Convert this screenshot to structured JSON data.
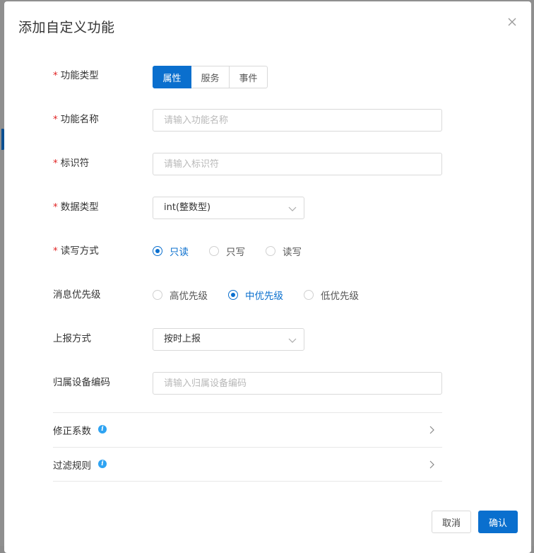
{
  "dialog": {
    "title": "添加自定义功能",
    "close_icon": "close-icon"
  },
  "form": {
    "function_type": {
      "label": "功能类型",
      "required": "*",
      "options": [
        "属性",
        "服务",
        "事件"
      ],
      "selected": "属性"
    },
    "function_name": {
      "label": "功能名称",
      "required": "*",
      "placeholder": "请输入功能名称",
      "value": ""
    },
    "identifier": {
      "label": "标识符",
      "required": "*",
      "placeholder": "请输入标识符",
      "value": ""
    },
    "data_type": {
      "label": "数据类型",
      "required": "*",
      "value": "int(整数型)"
    },
    "rw_mode": {
      "label": "读写方式",
      "required": "*",
      "options": [
        "只读",
        "只写",
        "读写"
      ],
      "selected": "只读"
    },
    "priority": {
      "label": "消息优先级",
      "options": [
        "高优先级",
        "中优先级",
        "低优先级"
      ],
      "selected": "中优先级"
    },
    "report_mode": {
      "label": "上报方式",
      "value": "按时上报"
    },
    "device_code": {
      "label": "归属设备编码",
      "placeholder": "请输入归属设备编码",
      "value": ""
    }
  },
  "panels": [
    {
      "label": "修正系数",
      "info_icon": "info-icon",
      "arrow_icon": "chevron-right-icon"
    },
    {
      "label": "过滤规则",
      "info_icon": "info-icon",
      "arrow_icon": "chevron-right-icon"
    }
  ],
  "footer": {
    "cancel_label": "取消",
    "confirm_label": "确认"
  },
  "colors": {
    "primary": "#0a6fce",
    "required": "#e02424",
    "info": "#2ea3f2"
  }
}
